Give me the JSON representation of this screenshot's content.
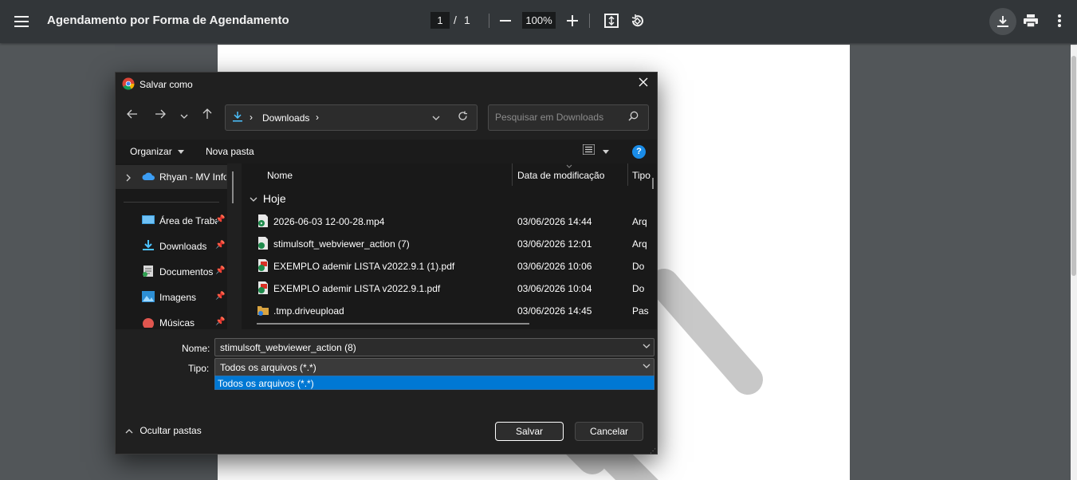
{
  "viewer": {
    "title": "Agendamento por Forma de Agendamento",
    "page_current": "1",
    "page_separator": "/",
    "page_total": "1",
    "zoom": "100%"
  },
  "dialog": {
    "title": "Salvar como",
    "address": {
      "folder": "Downloads",
      "separator": "›"
    },
    "search_placeholder": "Pesquisar em Downloads",
    "commands": {
      "organize": "Organizar",
      "new_folder": "Nova pasta"
    },
    "nav_pane": {
      "onedrive": "Rhyan - MV Infor",
      "items": [
        {
          "label": "Área de Trabalho",
          "icon": "desktop-icon"
        },
        {
          "label": "Downloads",
          "icon": "downloads-icon"
        },
        {
          "label": "Documentos",
          "icon": "documents-icon"
        },
        {
          "label": "Imagens",
          "icon": "pictures-icon"
        },
        {
          "label": "Músicas",
          "icon": "music-icon"
        }
      ]
    },
    "columns": {
      "name": "Nome",
      "date": "Data de modificação",
      "type": "Tipo"
    },
    "group": "Hoje",
    "files": [
      {
        "name": "2026-06-03 12-00-28.mp4",
        "date": "03/06/2026 14:44",
        "type": "Arq",
        "icon": "video-file-icon"
      },
      {
        "name": "stimulsoft_webviewer_action (7)",
        "date": "03/06/2026 12:01",
        "type": "Arq",
        "icon": "generic-file-icon"
      },
      {
        "name": "EXEMPLO ademir LISTA v2022.9.1 (1).pdf",
        "date": "03/06/2026 10:06",
        "type": "Do",
        "icon": "pdf-file-icon"
      },
      {
        "name": "EXEMPLO ademir LISTA v2022.9.1.pdf",
        "date": "03/06/2026 10:04",
        "type": "Do",
        "icon": "pdf-file-icon"
      },
      {
        "name": ".tmp.driveupload",
        "date": "03/06/2026 14:45",
        "type": "Pas",
        "icon": "folder-icon"
      }
    ],
    "name_label": "Nome:",
    "name_value": "stimulsoft_webviewer_action (8)",
    "type_label": "Tipo:",
    "type_value": "Todos os arquivos (*.*)",
    "type_options": [
      "Todos os arquivos (*.*)"
    ],
    "hide_folders": "Ocultar pastas",
    "save": "Salvar",
    "cancel": "Cancelar"
  },
  "colors": {
    "toolbar": "#323639",
    "dialog_bg": "#202020",
    "accent": "#0078d4",
    "download_icon": "#4cc2ff"
  }
}
